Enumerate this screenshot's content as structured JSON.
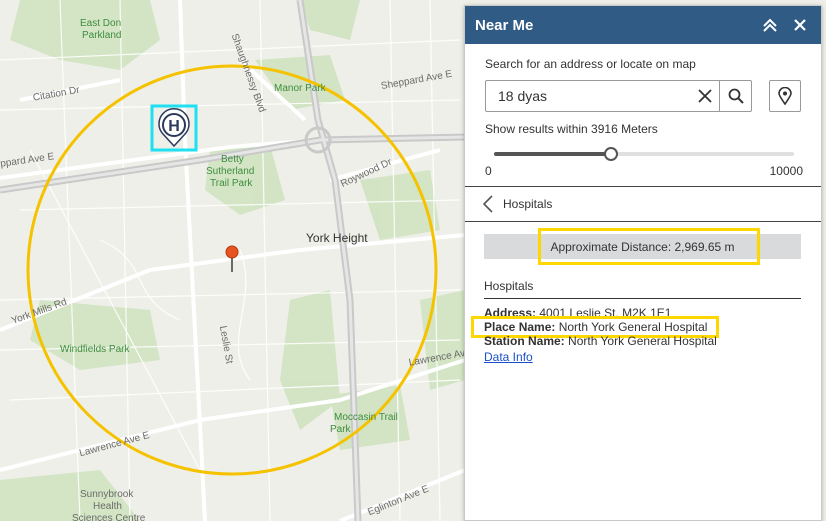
{
  "map": {
    "labels": {
      "east_don_parkland": "East Don\nParkland",
      "shaughnessy_blvd": "Shaughnessy Blvd",
      "manor_park": "Manor Park",
      "sheppard_ave_e_top": "Sheppard Ave E",
      "citation_dr": "Citation Dr",
      "sheppard_ave_e_left": "ppard Ave E",
      "betty_sutherland": "Betty\nSutherland\nTrail Park",
      "roywood_dr": "Roywood Dr",
      "york_height": "York Height",
      "york_mills_rd": "York Mills Rd",
      "leslie_st": "Leslie St",
      "windfields_park": "Windfields Park",
      "lawrence_ave_e_right": "Lawrence Av",
      "moccasin_trail_park": "Moccasin Trail\nPark",
      "lawrence_ave_e_left": "Lawrence Ave E",
      "eglinton_ave_e": "Eglinton Ave E",
      "sunnybrook": "Sunnybrook\nHealth\nSciences Centre"
    },
    "hospital_marker_letter": "H",
    "colors": {
      "buffer_circle": "#f5c200",
      "highlight": "#1ee0f0",
      "park": "#c8dfb8",
      "road": "#ffffff",
      "highway": "#cfcfcf",
      "location_pin": "#e8541f"
    }
  },
  "panel": {
    "title": "Near Me",
    "collapse_icon": "double-chevron-up-icon",
    "close_icon": "close-icon",
    "search_prompt": "Search for an address or locate on map",
    "search_value": "18 dyas",
    "radius_label": "Show results within 3916 Meters",
    "slider": {
      "min_label": "0",
      "max_label": "10000",
      "min": 0,
      "max": 10000,
      "value": 3916
    },
    "back_label": "Hospitals",
    "distance": "Approximate Distance: 2,969.65 m",
    "results_title": "Hospitals",
    "address_label": "Address:",
    "address_value": "4001 Leslie St, M2K 1E1",
    "place_label": "Place Name:",
    "place_value": "North York General Hospital",
    "station_label": "Station Name:",
    "station_value": "North York General Hospital",
    "data_info": "Data Info",
    "colors": {
      "header_bg": "#2f5b85",
      "highlight": "#ffd700",
      "link": "#1a4fc7"
    }
  }
}
